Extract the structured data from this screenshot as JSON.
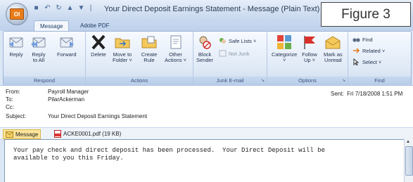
{
  "window": {
    "title": "Your Direct Deposit Earnings Statement - Message (Plain Text)",
    "office_button_label": "Ol"
  },
  "figure_label": "Figure 3",
  "qat_icons": [
    "save-icon",
    "undo-icon",
    "redo-icon",
    "up-arrow-icon",
    "down-arrow-icon"
  ],
  "tabs": [
    {
      "label": "Message",
      "active": true
    },
    {
      "label": "Adobe PDF",
      "active": false
    }
  ],
  "ribbon": {
    "groups": {
      "respond": {
        "label": "Respond",
        "buttons": [
          {
            "label_1": "Reply",
            "label_2": ""
          },
          {
            "label_1": "Reply",
            "label_2": "to All"
          },
          {
            "label_1": "Forward",
            "label_2": ""
          }
        ]
      },
      "actions": {
        "label": "Actions",
        "buttons": [
          {
            "label_1": "Delete",
            "label_2": ""
          },
          {
            "label_1": "Move to",
            "label_2": "Folder ˅"
          },
          {
            "label_1": "Create",
            "label_2": "Rule"
          },
          {
            "label_1": "Other",
            "label_2": "Actions ˅"
          }
        ]
      },
      "junk": {
        "label": "Junk E-mail",
        "block_1": "Block",
        "block_2": "Sender",
        "safe_lists": "Safe Lists ˅",
        "not_junk": "Not Junk"
      },
      "options": {
        "label": "Options",
        "buttons": [
          {
            "label_1": "Categorize",
            "label_2": "˅"
          },
          {
            "label_1": "Follow",
            "label_2": "Up ˅"
          },
          {
            "label_1": "Mark as",
            "label_2": "Unread"
          }
        ]
      },
      "find": {
        "label": "Find",
        "find": "Find",
        "related": "Related ˅",
        "select": "Select ˅"
      }
    }
  },
  "headers": {
    "from_label": "From:",
    "from_value": "Payroll Manager",
    "to_label": "To:",
    "to_value": "PilarAckerman",
    "cc_label": "Cc:",
    "cc_value": "",
    "subject_label": "Subject:",
    "subject_value": "Your Direct Deposit Earnings Statement",
    "sent_label": "Sent:",
    "sent_value": "Fri 7/18/2008 1:51 PM"
  },
  "attachments": {
    "message_label": "Message",
    "file_label": "ACKE0001.pdf (19 KB)"
  },
  "body": {
    "line_1": "Your pay check and direct deposit has been processed.  Your Direct Deposit will be",
    "line_2": "available to you this Friday."
  }
}
